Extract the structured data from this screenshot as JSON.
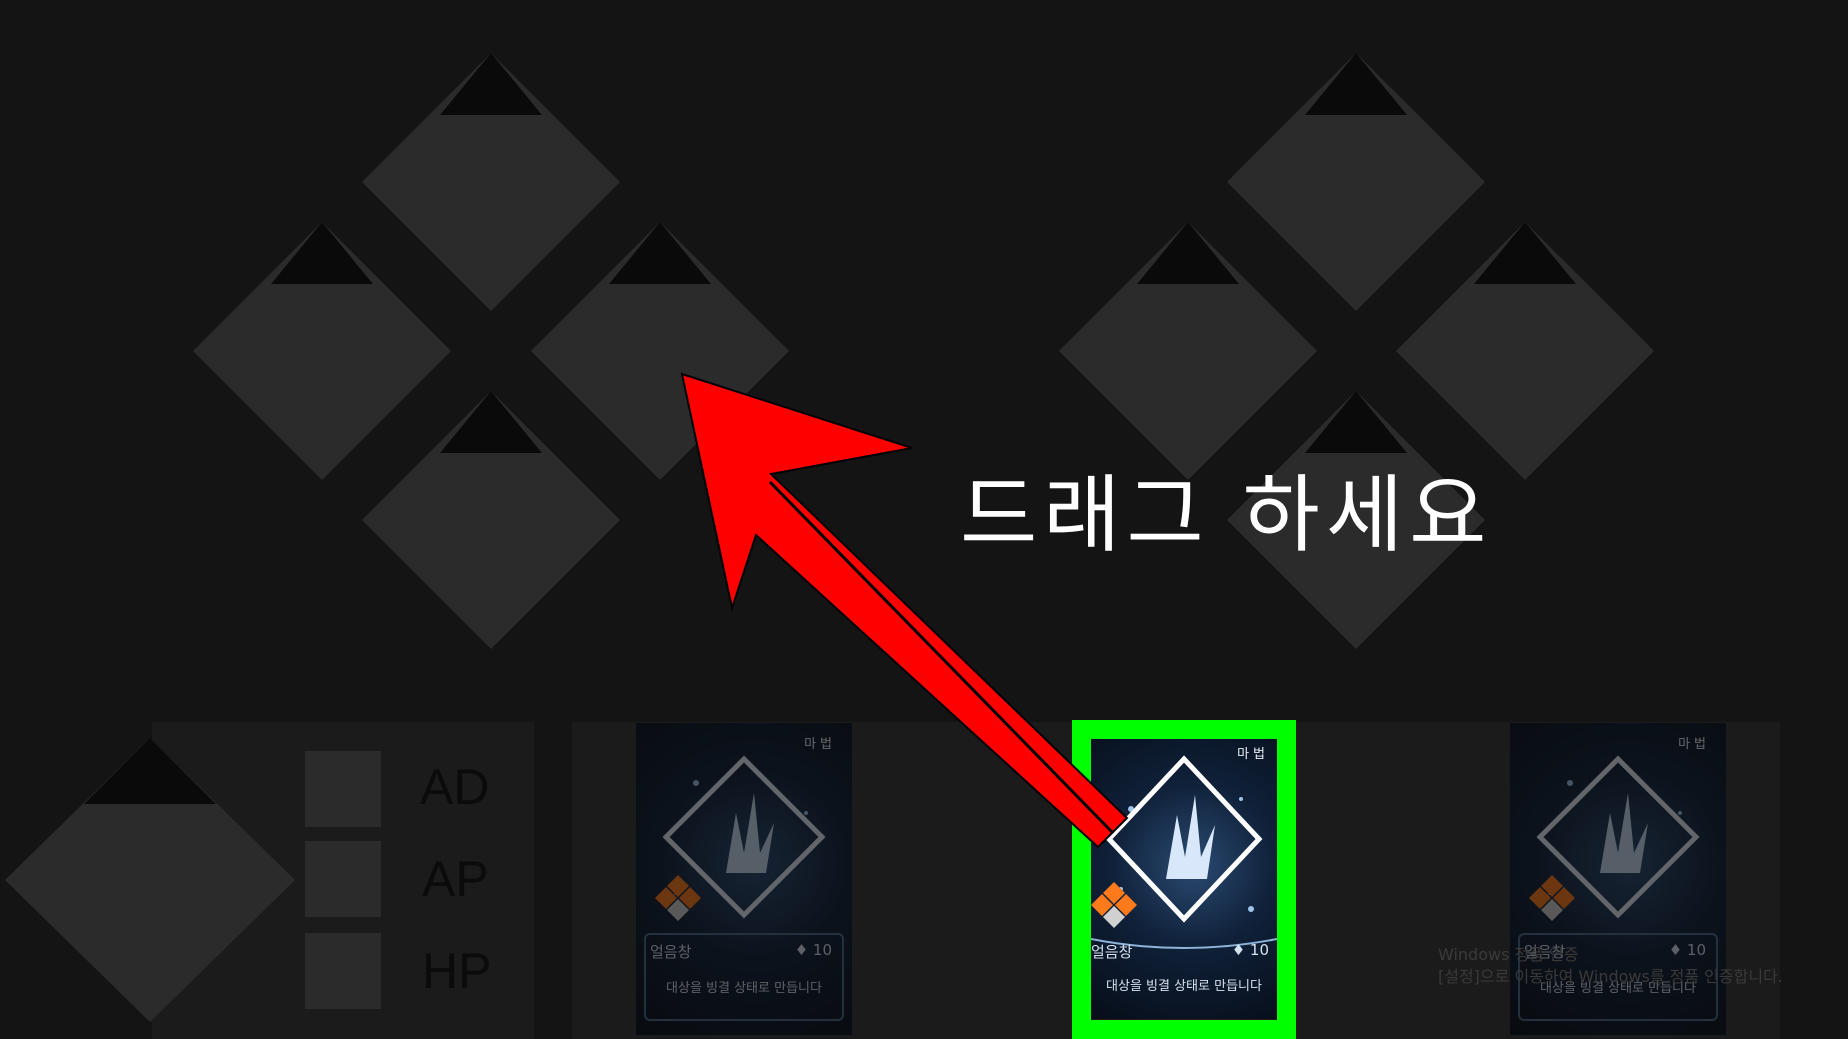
{
  "instruction": "드래그 하세요",
  "stats": [
    "AD",
    "AP",
    "HP"
  ],
  "card": {
    "type": "마법",
    "name": "얼음창",
    "cost": "10",
    "cost_icon": "diamond-icon",
    "description": "대상을 빙결 상태로 만듭니다"
  },
  "cards_in_hand": 3,
  "selected_card_index": 1,
  "watermark": {
    "title": "Windows 정품 인증",
    "subtitle": "[설정]으로 이동하여 Windows를 정품 인증합니다."
  },
  "colors": {
    "background": "#141414",
    "slot": "#2b2b2b",
    "slot_cap": "#0a0a0a",
    "highlight": "#00ff00",
    "arrow": "#ff0000",
    "text": "#ffffff"
  }
}
